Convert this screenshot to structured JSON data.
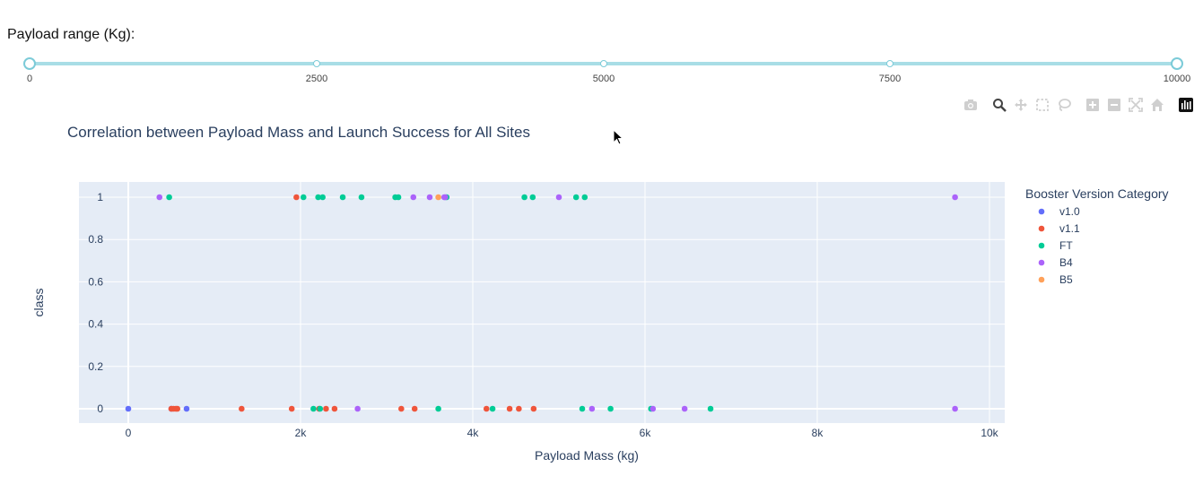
{
  "slider": {
    "label": "Payload range (Kg):",
    "min": 0,
    "max": 10000,
    "value": [
      0,
      10000
    ],
    "marks": [
      "0",
      "2500",
      "5000",
      "7500",
      "10000"
    ],
    "color": "#7ccbd8"
  },
  "modebar": [
    "camera-icon",
    "zoom-icon",
    "pan-icon",
    "box-select-icon",
    "lasso-select-icon",
    "zoom-in-icon",
    "zoom-out-icon",
    "autoscale-icon",
    "reset-axes-icon",
    "plotly-logo-icon"
  ],
  "chart_data": {
    "type": "scatter",
    "title": "Correlation between Payload Mass and Launch Success for All Sites",
    "xlabel": "Payload Mass (kg)",
    "ylabel": "class",
    "xlim": [
      -600,
      10200
    ],
    "ylim": [
      -0.07,
      1.07
    ],
    "x_ticks": [
      0,
      2000,
      4000,
      6000,
      8000,
      10000
    ],
    "x_tick_labels": [
      "0",
      "2k",
      "4k",
      "6k",
      "8k",
      "10k"
    ],
    "y_ticks": [
      0,
      0.2,
      0.4,
      0.6,
      0.8,
      1
    ],
    "y_tick_labels": [
      "0",
      "0.2",
      "0.4",
      "0.6",
      "0.8",
      "1"
    ],
    "grid": true,
    "plot_bgcolor": "#e5ecf6",
    "legend": {
      "title": "Booster Version Category",
      "placement": "right"
    },
    "series": [
      {
        "name": "v1.0",
        "color": "#636efa",
        "x": [
          0,
          500,
          677
        ],
        "y": [
          0,
          0,
          0
        ]
      },
      {
        "name": "v1.1",
        "color": "#ef553b",
        "x": [
          1952,
          500,
          525,
          553,
          570,
          1316,
          1898,
          2216,
          2296,
          2395,
          3170,
          3325,
          4159,
          4428,
          4535,
          4707
        ],
        "y": [
          1,
          0,
          0,
          0,
          0,
          0,
          0,
          0,
          0,
          0,
          0,
          0,
          0,
          0,
          0,
          0
        ]
      },
      {
        "name": "FT",
        "color": "#00cc96",
        "x": [
          475,
          2034,
          2205,
          2257,
          2490,
          2708,
          3100,
          3136,
          3696,
          4600,
          4696,
          5200,
          5300,
          2150,
          2227,
          3600,
          4230,
          5271,
          5600,
          6070,
          6761
        ],
        "y": [
          1,
          1,
          1,
          1,
          1,
          1,
          1,
          1,
          1,
          1,
          1,
          1,
          1,
          0,
          0,
          0,
          0,
          0,
          0,
          0,
          0
        ]
      },
      {
        "name": "B4",
        "color": "#ab63fa",
        "x": [
          362,
          3310,
          3500,
          3669,
          3681,
          5000,
          9600,
          2663,
          5384,
          6092,
          6460,
          9600
        ],
        "y": [
          1,
          1,
          1,
          1,
          1,
          1,
          1,
          0,
          0,
          0,
          0,
          0
        ]
      },
      {
        "name": "B5",
        "color": "#ffa15a",
        "x": [
          3600
        ],
        "y": [
          1
        ]
      }
    ]
  }
}
